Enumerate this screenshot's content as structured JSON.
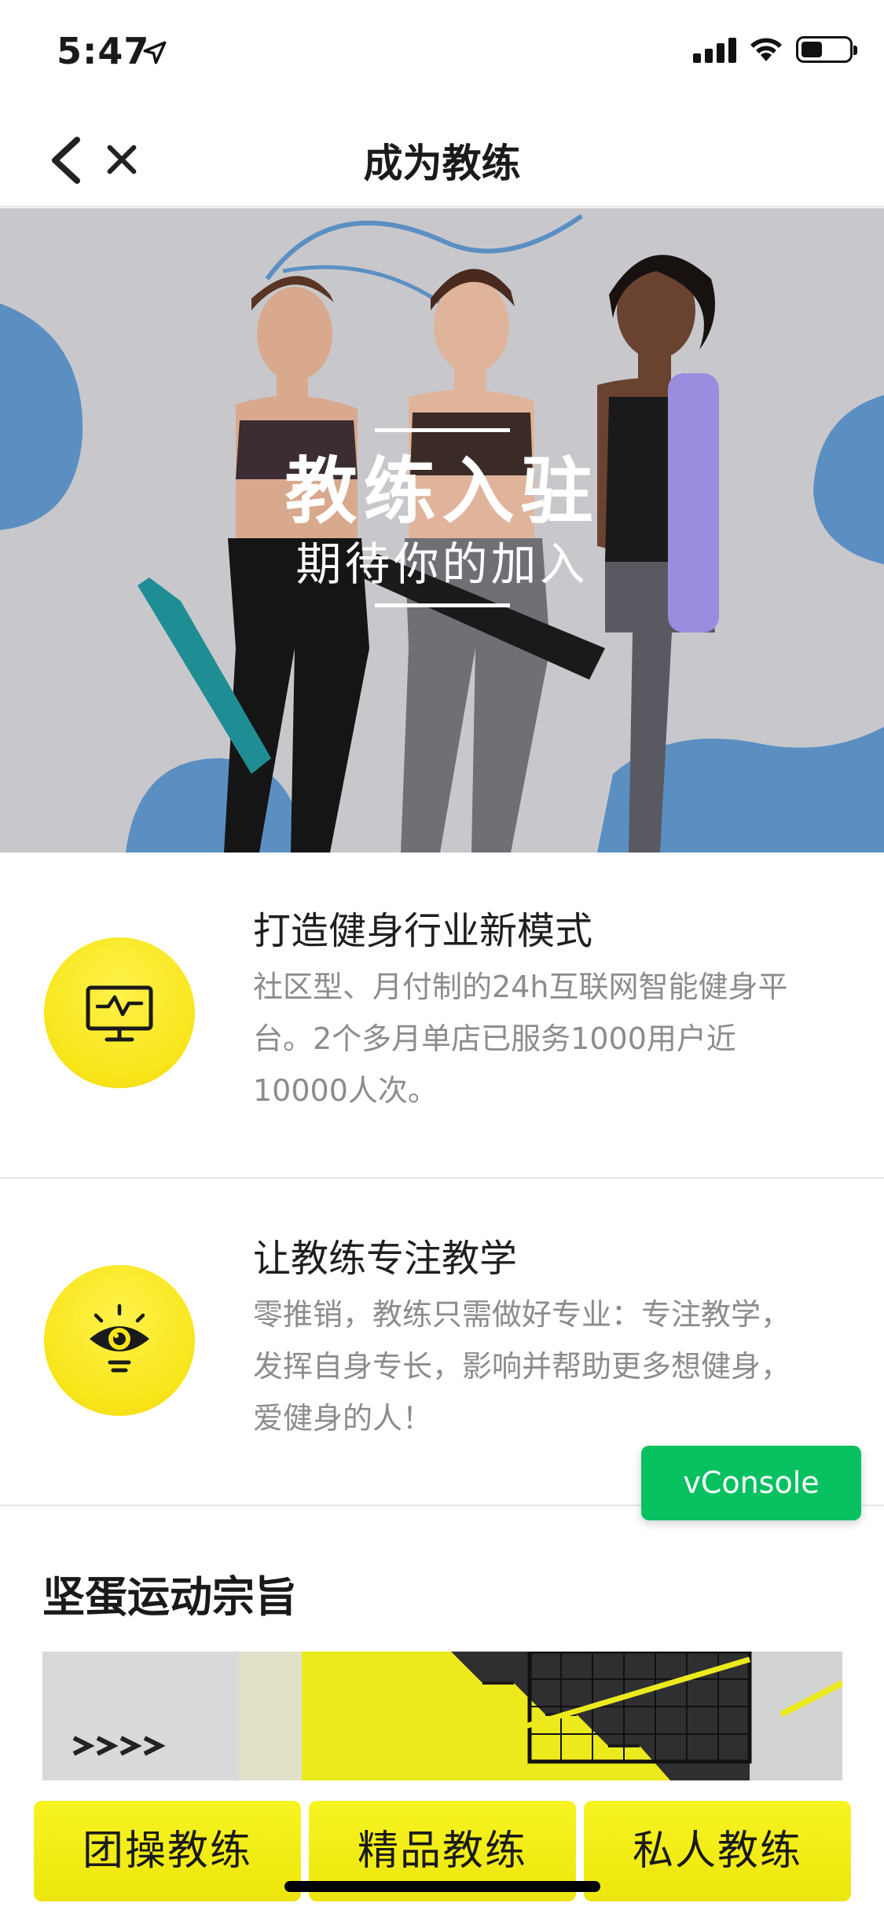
{
  "status_bar": {
    "time": "5:47",
    "icons": [
      "location-arrow-icon",
      "signal-icon",
      "wifi-icon",
      "battery-icon"
    ],
    "battery_level": 0.45
  },
  "nav": {
    "title": "成为教练",
    "back_icon": "chevron-left-icon",
    "close_icon": "close-icon"
  },
  "hero": {
    "title": "教练入驻",
    "subtitle": "期待你的加入"
  },
  "features": [
    {
      "icon": "monitor-chart-icon",
      "title": "打造健身行业新模式",
      "description": "社区型、月付制的24h互联网智能健身平台。2个多月单店已服务1000用户近10000人次。"
    },
    {
      "icon": "eye-bulb-icon",
      "title": "让教练专注教学",
      "description": "零推销，教练只需做好专业：专注教学，发挥自身专长，影响并帮助更多想健身，爱健身的人！"
    }
  ],
  "vconsole": {
    "label": "vConsole"
  },
  "mission": {
    "title": "坚蛋运动宗旨"
  },
  "bottom_tabs": [
    {
      "label": "团操教练"
    },
    {
      "label": "精品教练"
    },
    {
      "label": "私人教练"
    }
  ],
  "colors": {
    "accent_yellow": "#f5ee15",
    "vconsole_green": "#07c160",
    "hero_blue": "#5b8fc2",
    "text_gray": "#8c8c8c"
  }
}
